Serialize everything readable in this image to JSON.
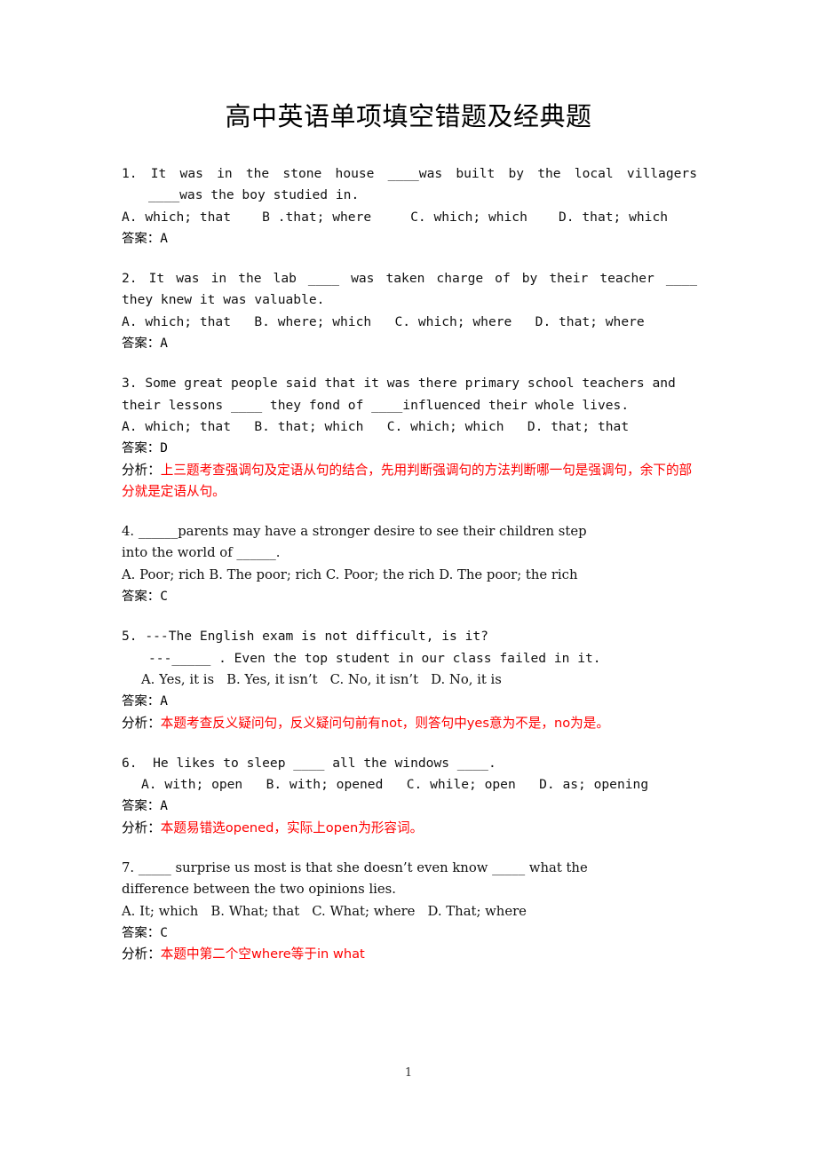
{
  "document": {
    "title": "高中英语单项填空错题及经典题",
    "page_number": "1",
    "answer_label": "答案：",
    "analysis_label": "分析：",
    "accent_red": "#ff0000",
    "text_color": "#111111"
  },
  "questions": [
    {
      "number": "1.",
      "stem_line1": "1.  It  was  in  the  stone  house  ____was  built  by  the  local  villagers",
      "stem_line2": "____was the boy studied in.",
      "options": "A. which; that    B .that; where     C. which; which    D. that; which",
      "answer_label": "答案：",
      "answer": "A",
      "analysis_label": "",
      "analysis": ""
    },
    {
      "number": "2.",
      "stem_line1": "2.  It was in the lab ____ was taken charge of by their teacher ____",
      "stem_line2": "they knew it was valuable.",
      "options": "A. which; that   B. where; which   C. which; where   D. that; where",
      "answer_label": "答案：",
      "answer": "A",
      "analysis_label": "",
      "analysis": ""
    },
    {
      "number": "3.",
      "stem_line1": "3. Some great people said that it was there primary school teachers and",
      "stem_line2": "their lessons ____ they fond of ____influenced their whole lives.",
      "options": "A. which; that   B. that; which   C. which; which   D. that; that",
      "answer_label": "答案：",
      "answer": "D",
      "analysis_label": "分析：",
      "analysis": "上三题考查强调句及定语从句的结合，先用判断强调句的方法判断哪一句是强调句，余下的部分就是定语从句。"
    },
    {
      "number": "4.",
      "stem_line1": "4. ______parents may have a stronger desire to see their children step",
      "stem_line2": "into the world of ______.",
      "options": "A. Poor; rich   B. The poor; rich    C. Poor; the rich   D. The poor; the rich",
      "answer_label": "答案：",
      "answer": "C",
      "analysis_label": "",
      "analysis": ""
    },
    {
      "number": "5.",
      "stem_line1": "5. ---The English exam is not difficult, is it?",
      "stem_line2": "---_____ . Even the top student in our class failed in it.",
      "options": "A. Yes, it is   B. Yes, it isn’t   C. No, it isn’t   D. No, it is",
      "answer_label": "答案：",
      "answer": "A",
      "analysis_label": "分析：",
      "analysis": "本题考查反义疑问句，反义疑问句前有not，则答句中yes意为不是，no为是。"
    },
    {
      "number": "6.",
      "stem_line1": "6.  He likes to sleep ____ all the windows ____.",
      "stem_line2": "",
      "options": "A. with; open   B. with; opened   C. while; open   D. as; opening",
      "answer_label": "答案：",
      "answer": "A",
      "analysis_label": "分析：",
      "analysis": "本题易错选opened，实际上open为形容词。"
    },
    {
      "number": "7.",
      "stem_line1": "7. _____ surprise us most is that she doesn’t even know _____ what the",
      "stem_line2": "difference between the two opinions lies.",
      "options": "A. It; which   B. What; that   C. What; where   D. That; where",
      "answer_label": "答案：",
      "answer": "C",
      "analysis_label": "分析：",
      "analysis": "本题中第二个空where等于in what"
    }
  ]
}
